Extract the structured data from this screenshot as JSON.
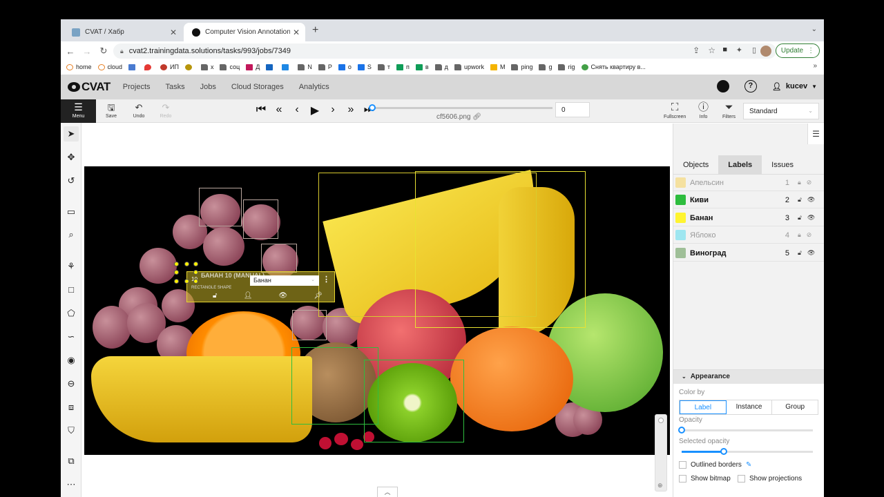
{
  "browser": {
    "tabs": [
      {
        "title": "CVAT / Хабр",
        "active": false
      },
      {
        "title": "Computer Vision Annotation To",
        "active": true
      }
    ],
    "url": "cvat2.trainingdata.solutions/tasks/993/jobs/7349",
    "update_label": "Update",
    "bookmarks": [
      "home",
      "cloud",
      "ИП",
      "х",
      "соц",
      "Д",
      "N",
      "Р",
      "о",
      "S",
      "т",
      "п",
      "в",
      "д",
      "upwork",
      "M",
      "ping",
      "g",
      "rig",
      "Снять квартиру в..."
    ]
  },
  "header": {
    "logo": "CVAT",
    "nav": [
      "Projects",
      "Tasks",
      "Jobs",
      "Cloud Storages",
      "Analytics"
    ],
    "user": "kucev"
  },
  "toolbar": {
    "menu": "Menu",
    "save": "Save",
    "undo": "Undo",
    "redo": "Redo",
    "frame": "0",
    "filename": "cf5606.png",
    "fullscreen": "Fullscreen",
    "info": "Info",
    "filters": "Filters",
    "workspace": "Standard"
  },
  "popup": {
    "title": "БАНАН 10 (MANUAL)",
    "id": "10",
    "subtitle": "RECTANGLE SHAPE",
    "label_value": "Банан"
  },
  "panel": {
    "tabs": [
      "Objects",
      "Labels",
      "Issues"
    ],
    "labels": [
      {
        "name": "Апельсин",
        "key": "1",
        "color": "#f5e1a0",
        "hidden": true
      },
      {
        "name": "Киви",
        "key": "2",
        "color": "#2ebd3e",
        "hidden": false
      },
      {
        "name": "Банан",
        "key": "3",
        "color": "#fff430",
        "hidden": false
      },
      {
        "name": "Яблоко",
        "key": "4",
        "color": "#9ee6f0",
        "hidden": true
      },
      {
        "name": "Виноград",
        "key": "5",
        "color": "#9fbf98",
        "hidden": false
      }
    ],
    "appearance": {
      "title": "Appearance",
      "color_by": "Color by",
      "color_options": [
        "Label",
        "Instance",
        "Group"
      ],
      "selected_color_option": "Label",
      "opacity_label": "Opacity",
      "opacity": 0,
      "selected_opacity_label": "Selected opacity",
      "selected_opacity": 0.32,
      "outlined_borders": "Outlined borders",
      "show_bitmap": "Show bitmap",
      "show_projections": "Show projections"
    }
  }
}
